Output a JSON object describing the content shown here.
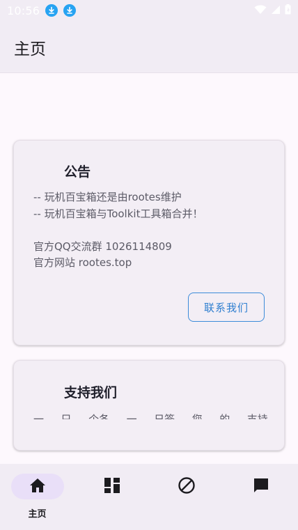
{
  "status_bar": {
    "time": "10:56",
    "icons": [
      "download-icon",
      "download-icon",
      "wifi-icon",
      "signal-icon",
      "battery-icon"
    ]
  },
  "app_bar": {
    "title": "主页"
  },
  "notice_card": {
    "title": "公告",
    "lines": [
      "-- 玩机百宝箱还是由rootes维护",
      "-- 玩机百宝箱与Toolkit工具箱合并！",
      "",
      "官方QQ交流群 1026114809",
      "官方网站 rootes.top"
    ],
    "button_label": "联系我们"
  },
  "support_card": {
    "title": "支持我们",
    "partial_text": "一 … 只 … 个各 … 一 … 日签 … 您 … 的 … 支持 … 将 … 帮助 … 我"
  },
  "bottom_nav": {
    "items": [
      {
        "icon": "home-icon",
        "label": "主页",
        "active": true
      },
      {
        "icon": "dashboard-icon",
        "label": "",
        "active": false
      },
      {
        "icon": "block-icon",
        "label": "",
        "active": false
      },
      {
        "icon": "chat-icon",
        "label": "",
        "active": false
      }
    ]
  },
  "colors": {
    "background": "#fdf8fd",
    "bars": "#f1ecf4",
    "card": "#f3eef5",
    "accent_blue": "#2f7fd0",
    "download_badge": "#27a3f2",
    "nav_active_pill": "#e9dff8"
  }
}
